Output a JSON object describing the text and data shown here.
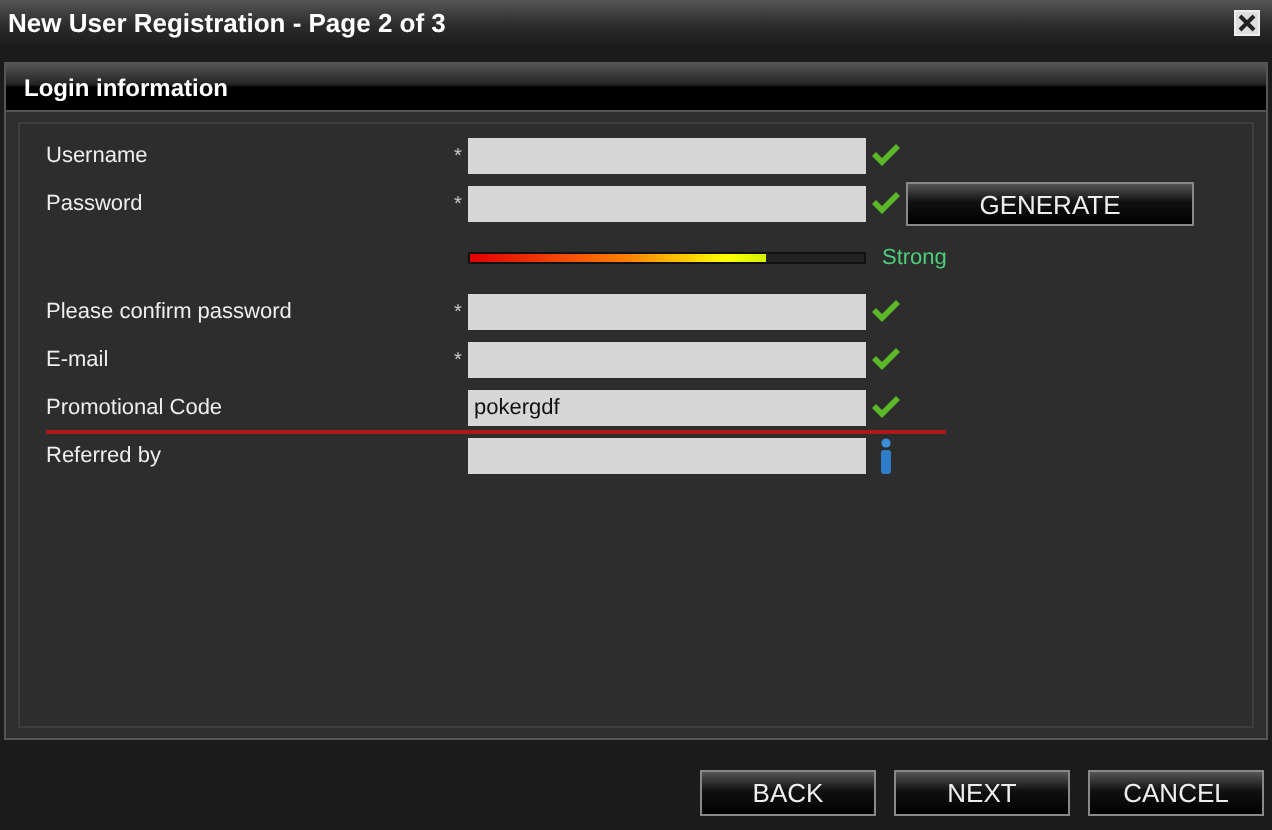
{
  "window": {
    "title": "New User Registration - Page 2 of 3"
  },
  "panel": {
    "title": "Login information"
  },
  "rows": [
    {
      "kind": "field",
      "label": "Username",
      "marker": "*",
      "value": "",
      "valid": true
    },
    {
      "kind": "field",
      "label": "Password",
      "marker": "*",
      "value": "",
      "valid": true,
      "button": "GENERATE"
    },
    {
      "kind": "strength",
      "level": 0.75,
      "reading": "Strong"
    },
    {
      "kind": "field",
      "label": "Please confirm password",
      "marker": "*",
      "value": "",
      "valid": true
    },
    {
      "kind": "field",
      "label": "E-mail",
      "marker": "*",
      "value": "",
      "valid": true
    },
    {
      "kind": "field",
      "label": "Promotional Code",
      "value": "pokergdf",
      "valid": true,
      "underlined": true
    },
    {
      "kind": "field",
      "label": "Referred by",
      "value": "",
      "valid": false
    }
  ],
  "buttons": [
    "BACK",
    "NEXT",
    "CANCEL"
  ]
}
